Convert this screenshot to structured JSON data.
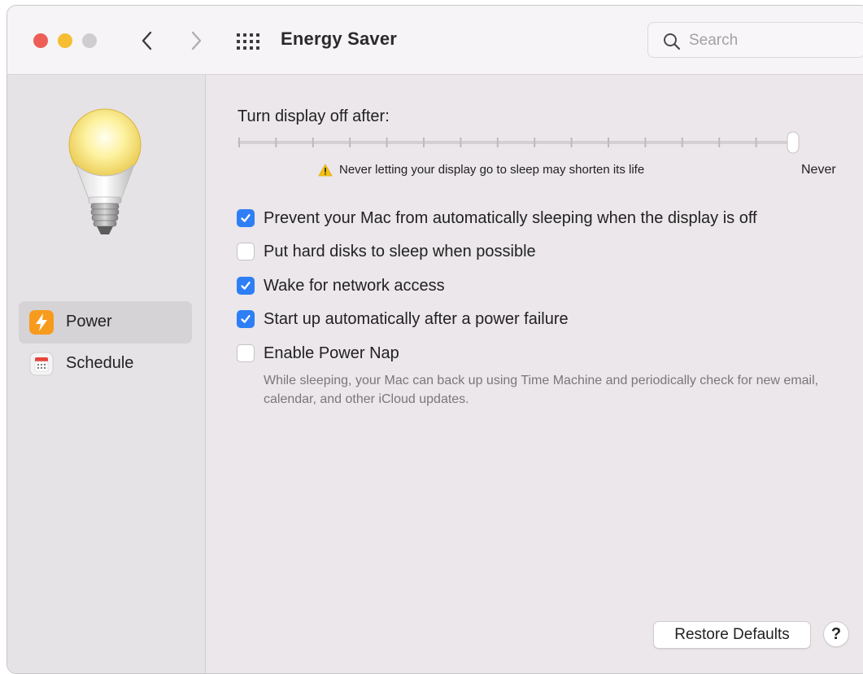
{
  "window": {
    "title": "Energy Saver",
    "search": {
      "placeholder": "Search",
      "value": ""
    }
  },
  "sidebar": {
    "items": [
      {
        "label": "Power",
        "icon": "lightning-bolt-icon",
        "selected": true
      },
      {
        "label": "Schedule",
        "icon": "calendar-icon",
        "selected": false
      }
    ]
  },
  "display": {
    "label": "Turn display off after:",
    "slider_level": 1.0,
    "tick_count": 16,
    "warning": "Never letting your display go to sleep may shorten its life",
    "end_label": "Never"
  },
  "options": [
    {
      "label": "Prevent your Mac from automatically sleeping when the display is off",
      "checked": true
    },
    {
      "label": "Put hard disks to sleep when possible",
      "checked": false
    },
    {
      "label": "Wake for network access",
      "checked": true
    },
    {
      "label": "Start up automatically after a power failure",
      "checked": true
    },
    {
      "label": "Enable Power Nap",
      "checked": false
    }
  ],
  "power_nap_description": "While sleeping, your Mac can back up using Time Machine and periodically check for new email, calendar, and other iCloud updates.",
  "footer": {
    "restore_label": "Restore Defaults",
    "help_label": "?"
  },
  "colors": {
    "accent": "#2e7ff5",
    "close": "#ee5e58",
    "minimize": "#f6bd32",
    "zoom": "#cfcdcf",
    "warning": "#f5c211",
    "power_icon": "#f79b1d"
  }
}
